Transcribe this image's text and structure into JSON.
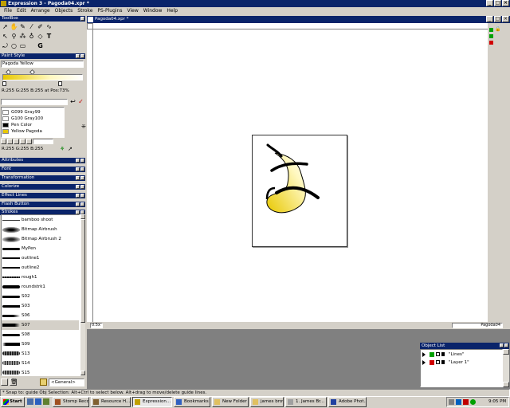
{
  "app": {
    "title": "Expression 3 - Pagoda04.xpr *"
  },
  "menu": [
    "File",
    "Edit",
    "Arrange",
    "Objects",
    "Stroke",
    "PS-Plugins",
    "View",
    "Window",
    "Help"
  ],
  "toolbox": {
    "title": "ToolBox"
  },
  "paint_style": {
    "title": "Paint Style",
    "name": "Pagoda Yellow",
    "readout": "R:255 G:255 B:255 at Pos:73%",
    "colors": [
      {
        "label": "G099 Gray99",
        "color": "#fcfcfc"
      },
      {
        "label": "G100 Gray100",
        "color": "#ffffff"
      },
      {
        "label": "Pen Color",
        "color": "#000000"
      },
      {
        "label": "Yellow Pagoda",
        "color": "#e8c800"
      }
    ],
    "footer": "R:255 G:255 B:255"
  },
  "panels": [
    "Attributes",
    "Font",
    "Transformation",
    "Colorize",
    "Effect Lines",
    "Flash Button",
    "Strokes"
  ],
  "strokes": [
    {
      "label": "bamboo shoot"
    },
    {
      "label": "Bitmap Airbrush"
    },
    {
      "label": "Bitmap Airbrush 2"
    },
    {
      "label": "MyPen"
    },
    {
      "label": "outline1"
    },
    {
      "label": "outline2"
    },
    {
      "label": "rough1"
    },
    {
      "label": "roundstrk1"
    },
    {
      "label": "S02"
    },
    {
      "label": "S03"
    },
    {
      "label": "S06"
    },
    {
      "label": "S07"
    },
    {
      "label": "S08"
    },
    {
      "label": "S09"
    },
    {
      "label": "S13"
    },
    {
      "label": "S14"
    },
    {
      "label": "S15"
    }
  ],
  "strokes_dropdown": "<General>",
  "document": {
    "title": "Pagoda04.xpr *",
    "zoom": "0.5x",
    "status_name": "Pagoda04"
  },
  "object_list": {
    "title": "Object List",
    "items": [
      {
        "label": "\"Lines\""
      },
      {
        "label": "\"Layer 1\""
      }
    ]
  },
  "status_bar": "* Snap to: guide   Obj Selection: Alt+Ctrl to select below. Alt+drag to move/delete guide lines.",
  "taskbar": {
    "start": "Start",
    "buttons": [
      "Stomp Reco...",
      "Resource H...",
      "Expression...",
      "Bookmarks ...",
      "New Folder",
      "james brown",
      "1. James Br...",
      "Adobe Phot..."
    ],
    "clock": "9:05 PM"
  },
  "colors": {
    "titlebar": "#0a246a",
    "desktop": "#808080",
    "fill_yellow": "#e8c800"
  }
}
